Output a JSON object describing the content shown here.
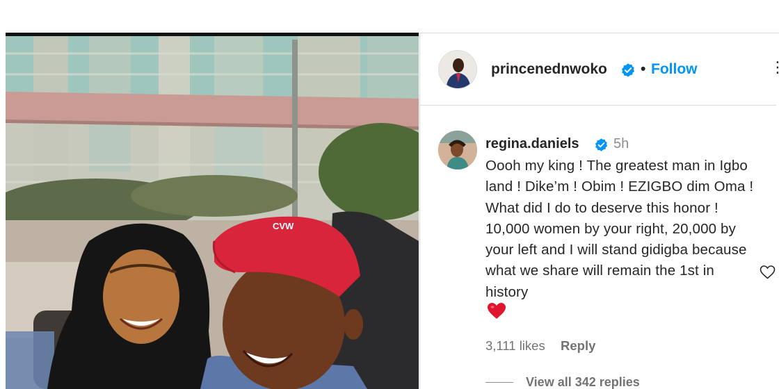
{
  "post_author": {
    "username": "princenednwoko",
    "separator": "•",
    "follow_label": "Follow",
    "more_icon": "more-options-icon"
  },
  "comment": {
    "username": "regina.daniels",
    "time": "5h",
    "text": "Oooh my king ! The greatest man in Igbo land ! Dike’m ! Obim ! EZIGBO dim Oma ! What did I do to deserve this honor ! 10,000 women by your right, 20,000 by your left and I will stand gidigba because what we share will remain the 1st in history",
    "emoji": "red-heart-emoji",
    "likes": "3,111 likes",
    "reply_label": "Reply",
    "view_replies": "View all 342 replies"
  },
  "colors": {
    "link_blue": "#0095f6",
    "verified_blue": "#0095f6",
    "text": "#262626",
    "secondary": "#737373",
    "divider": "#dbdbdb",
    "heart_red": "#e0142c",
    "cap_red": "#d8253b"
  }
}
